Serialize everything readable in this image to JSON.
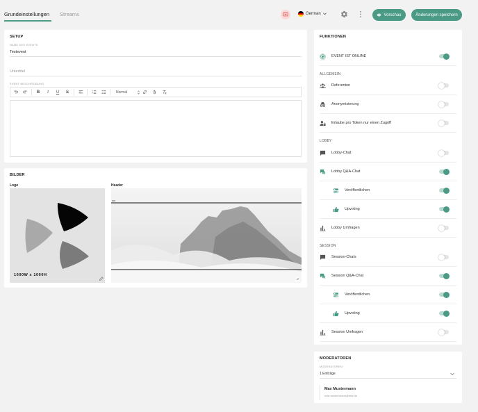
{
  "tabs": [
    {
      "label": "Grundeinstellungen",
      "active": true
    },
    {
      "label": "Streams",
      "active": false
    }
  ],
  "header": {
    "language": "German",
    "preview_label": "Vorschau",
    "save_label": "Änderungen speichern",
    "accent_color": "#4a9a86"
  },
  "setup": {
    "title": "SETUP",
    "event_name_label": "NAME DES EVENTS",
    "event_name_value": "Testevent",
    "subtitle_placeholder": "Untertitel",
    "description_label": "EVENT BESCHREIBUNG",
    "format_select": "Normal",
    "toolbar_icons": [
      "undo-icon",
      "redo-icon",
      "bold-icon",
      "italic-icon",
      "underline-icon",
      "strikethrough-icon",
      "align-icon",
      "ordered-list-icon",
      "bullet-list-icon",
      "link-icon",
      "attachment-icon",
      "clear-format-icon"
    ]
  },
  "bilder": {
    "title": "BILDER",
    "logo_label": "Logo",
    "logo_size": "1000W x 1000H",
    "header_label": "Header"
  },
  "funktionen": {
    "title": "FUNKTIONEN",
    "online": {
      "label": "EVENT IST ONLINE",
      "on": true
    },
    "allgemein_label": "ALLGEMEIN",
    "allgemein": [
      {
        "label": "Referenten",
        "icon": "speakers-icon",
        "on": false
      },
      {
        "label": "Anonymisierung",
        "icon": "incognito-icon",
        "on": false
      },
      {
        "label": "Erlaube pro Token nur einen Zugriff",
        "icon": "user-lock-icon",
        "on": false
      }
    ],
    "lobby_label": "LOBBY",
    "lobby": [
      {
        "label": "Lobby-Chat",
        "icon": "chat-icon",
        "on": false
      },
      {
        "label": "Lobby Q&A-Chat",
        "icon": "qa-chat-icon",
        "on": true
      },
      {
        "label": "Veröffentlichen",
        "icon": "publish-icon",
        "on": true,
        "sub": true
      },
      {
        "label": "Upvoting",
        "icon": "thumbs-up-icon",
        "on": true,
        "sub": true
      },
      {
        "label": "Lobby Umfragen",
        "icon": "poll-icon",
        "on": false
      }
    ],
    "session_label": "SESSION",
    "session": [
      {
        "label": "Session-Chats",
        "icon": "chat-icon",
        "on": false
      },
      {
        "label": "Session Q&A-Chat",
        "icon": "qa-chat-icon",
        "on": true
      },
      {
        "label": "Veröffentlichen",
        "icon": "publish-icon",
        "on": true,
        "sub": true
      },
      {
        "label": "Upvoting",
        "icon": "thumbs-up-icon",
        "on": true,
        "sub": true
      },
      {
        "label": "Session Umfragen",
        "icon": "poll-icon",
        "on": false
      }
    ]
  },
  "moderatoren": {
    "title": "MODERATOREN",
    "select_label": "MODERATOREN",
    "select_value": "1 Einträge",
    "entries": [
      {
        "name": "Max Mustermann",
        "email": "max.mustermann@test.de"
      }
    ]
  }
}
